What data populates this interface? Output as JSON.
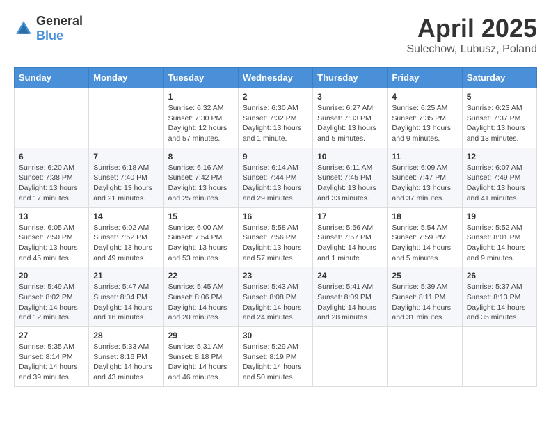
{
  "header": {
    "logo_general": "General",
    "logo_blue": "Blue",
    "month_title": "April 2025",
    "location": "Sulechow, Lubusz, Poland"
  },
  "columns": [
    "Sunday",
    "Monday",
    "Tuesday",
    "Wednesday",
    "Thursday",
    "Friday",
    "Saturday"
  ],
  "weeks": [
    [
      {
        "day": "",
        "info": ""
      },
      {
        "day": "",
        "info": ""
      },
      {
        "day": "1",
        "info": "Sunrise: 6:32 AM\nSunset: 7:30 PM\nDaylight: 12 hours and 57 minutes."
      },
      {
        "day": "2",
        "info": "Sunrise: 6:30 AM\nSunset: 7:32 PM\nDaylight: 13 hours and 1 minute."
      },
      {
        "day": "3",
        "info": "Sunrise: 6:27 AM\nSunset: 7:33 PM\nDaylight: 13 hours and 5 minutes."
      },
      {
        "day": "4",
        "info": "Sunrise: 6:25 AM\nSunset: 7:35 PM\nDaylight: 13 hours and 9 minutes."
      },
      {
        "day": "5",
        "info": "Sunrise: 6:23 AM\nSunset: 7:37 PM\nDaylight: 13 hours and 13 minutes."
      }
    ],
    [
      {
        "day": "6",
        "info": "Sunrise: 6:20 AM\nSunset: 7:38 PM\nDaylight: 13 hours and 17 minutes."
      },
      {
        "day": "7",
        "info": "Sunrise: 6:18 AM\nSunset: 7:40 PM\nDaylight: 13 hours and 21 minutes."
      },
      {
        "day": "8",
        "info": "Sunrise: 6:16 AM\nSunset: 7:42 PM\nDaylight: 13 hours and 25 minutes."
      },
      {
        "day": "9",
        "info": "Sunrise: 6:14 AM\nSunset: 7:44 PM\nDaylight: 13 hours and 29 minutes."
      },
      {
        "day": "10",
        "info": "Sunrise: 6:11 AM\nSunset: 7:45 PM\nDaylight: 13 hours and 33 minutes."
      },
      {
        "day": "11",
        "info": "Sunrise: 6:09 AM\nSunset: 7:47 PM\nDaylight: 13 hours and 37 minutes."
      },
      {
        "day": "12",
        "info": "Sunrise: 6:07 AM\nSunset: 7:49 PM\nDaylight: 13 hours and 41 minutes."
      }
    ],
    [
      {
        "day": "13",
        "info": "Sunrise: 6:05 AM\nSunset: 7:50 PM\nDaylight: 13 hours and 45 minutes."
      },
      {
        "day": "14",
        "info": "Sunrise: 6:02 AM\nSunset: 7:52 PM\nDaylight: 13 hours and 49 minutes."
      },
      {
        "day": "15",
        "info": "Sunrise: 6:00 AM\nSunset: 7:54 PM\nDaylight: 13 hours and 53 minutes."
      },
      {
        "day": "16",
        "info": "Sunrise: 5:58 AM\nSunset: 7:56 PM\nDaylight: 13 hours and 57 minutes."
      },
      {
        "day": "17",
        "info": "Sunrise: 5:56 AM\nSunset: 7:57 PM\nDaylight: 14 hours and 1 minute."
      },
      {
        "day": "18",
        "info": "Sunrise: 5:54 AM\nSunset: 7:59 PM\nDaylight: 14 hours and 5 minutes."
      },
      {
        "day": "19",
        "info": "Sunrise: 5:52 AM\nSunset: 8:01 PM\nDaylight: 14 hours and 9 minutes."
      }
    ],
    [
      {
        "day": "20",
        "info": "Sunrise: 5:49 AM\nSunset: 8:02 PM\nDaylight: 14 hours and 12 minutes."
      },
      {
        "day": "21",
        "info": "Sunrise: 5:47 AM\nSunset: 8:04 PM\nDaylight: 14 hours and 16 minutes."
      },
      {
        "day": "22",
        "info": "Sunrise: 5:45 AM\nSunset: 8:06 PM\nDaylight: 14 hours and 20 minutes."
      },
      {
        "day": "23",
        "info": "Sunrise: 5:43 AM\nSunset: 8:08 PM\nDaylight: 14 hours and 24 minutes."
      },
      {
        "day": "24",
        "info": "Sunrise: 5:41 AM\nSunset: 8:09 PM\nDaylight: 14 hours and 28 minutes."
      },
      {
        "day": "25",
        "info": "Sunrise: 5:39 AM\nSunset: 8:11 PM\nDaylight: 14 hours and 31 minutes."
      },
      {
        "day": "26",
        "info": "Sunrise: 5:37 AM\nSunset: 8:13 PM\nDaylight: 14 hours and 35 minutes."
      }
    ],
    [
      {
        "day": "27",
        "info": "Sunrise: 5:35 AM\nSunset: 8:14 PM\nDaylight: 14 hours and 39 minutes."
      },
      {
        "day": "28",
        "info": "Sunrise: 5:33 AM\nSunset: 8:16 PM\nDaylight: 14 hours and 43 minutes."
      },
      {
        "day": "29",
        "info": "Sunrise: 5:31 AM\nSunset: 8:18 PM\nDaylight: 14 hours and 46 minutes."
      },
      {
        "day": "30",
        "info": "Sunrise: 5:29 AM\nSunset: 8:19 PM\nDaylight: 14 hours and 50 minutes."
      },
      {
        "day": "",
        "info": ""
      },
      {
        "day": "",
        "info": ""
      },
      {
        "day": "",
        "info": ""
      }
    ]
  ]
}
